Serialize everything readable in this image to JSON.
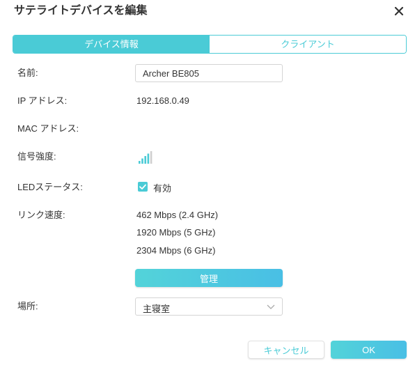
{
  "dialog": {
    "title": "サテライトデバイスを編集"
  },
  "tabs": [
    {
      "label": "デバイス情報",
      "active": true
    },
    {
      "label": "クライアント",
      "active": false
    }
  ],
  "fields": {
    "name_label": "名前:",
    "name_value": "Archer BE805",
    "ip_label": "IP アドレス:",
    "ip_value": "192.168.0.49",
    "mac_label": "MAC アドレス:",
    "mac_value": "",
    "signal_label": "信号強度:",
    "signal_level": 4,
    "signal_max": 5,
    "led_label": "LEDステータス:",
    "led_checked": true,
    "led_value": "有効",
    "link_label": "リンク速度:",
    "link_speeds": [
      "462 Mbps (2.4 GHz)",
      "1920 Mbps (5 GHz)",
      "2304 Mbps (6 GHz)"
    ],
    "manage_label": "管理",
    "location_label": "場所:",
    "location_value": "主寝室"
  },
  "footer": {
    "cancel_label": "キャンセル",
    "ok_label": "OK"
  },
  "colors": {
    "accent": "#4acbd6",
    "text": "#333333",
    "border": "#d4d4d4"
  },
  "icons": {
    "close": "close-icon",
    "signal": "signal-strength-icon",
    "check": "check-icon",
    "chevron": "chevron-down-icon"
  }
}
